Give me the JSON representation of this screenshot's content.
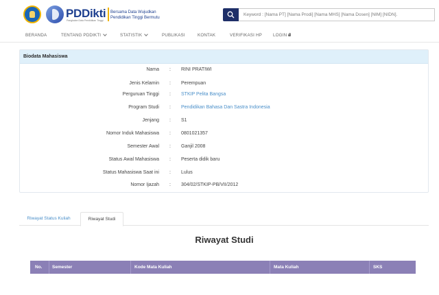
{
  "header": {
    "brand": "PDDikti",
    "brand_sub": "Pangkalan Data Pendidikan Tinggi",
    "tagline": "Bersama Data Wujudkan\nPendidikan Tinggi Bermutu",
    "search_placeholder": "Keyword : [Nama PT] [Nama Prodi] [Nama MHS] [Nama Dosen] [NIM] [NIDN]."
  },
  "nav": {
    "items": [
      "BERANDA",
      "TENTANG PDDIKTI",
      "STATISTIK",
      "PUBLIKASI",
      "KONTAK",
      "VERIFIKASI HP",
      "LOGIN"
    ]
  },
  "biodata": {
    "title": "Biodata Mahasiswa",
    "separator": ":",
    "rows": [
      {
        "label": "Nama",
        "value": "RINI PRATIWI"
      },
      {
        "label": "Jenis Kelamin",
        "value": "Perempuan"
      },
      {
        "label": "Perguruan Tinggi",
        "value": "STKIP Pelita Bangsa"
      },
      {
        "label": "Program Studi",
        "value": "Pendidikan Bahasa Dan Sastra Indonesia"
      },
      {
        "label": "Jenjang",
        "value": "S1"
      },
      {
        "label": "Nomor Induk Mahasiswa",
        "value": "0801021357"
      },
      {
        "label": "Semester Awal",
        "value": "Ganjil 2008"
      },
      {
        "label": "Status Awal Mahasiswa",
        "value": "Peserta didik baru"
      },
      {
        "label": "Status Mahasiswa Saat ini",
        "value": "Lulus"
      },
      {
        "label": "Nomor Ijazah",
        "value": "304/02/STKIP-PB/VII/2012"
      }
    ]
  },
  "tabs": {
    "status_kuliah": "Riwayat Status Kuliah",
    "studi": "Riwayat Studi",
    "active": "Riwayat Studi"
  },
  "studi": {
    "title": "Riwayat Studi",
    "columns": [
      "No.",
      "Semester",
      "Kode Mata Kuliah",
      "Mata Kuliah",
      "SKS"
    ]
  },
  "colors": {
    "table_header": "#8b80b6",
    "panel_header": "#dff0fa",
    "link": "#4a8fc9",
    "search_button": "#1e2f68",
    "brand": "#1d3f8f"
  }
}
